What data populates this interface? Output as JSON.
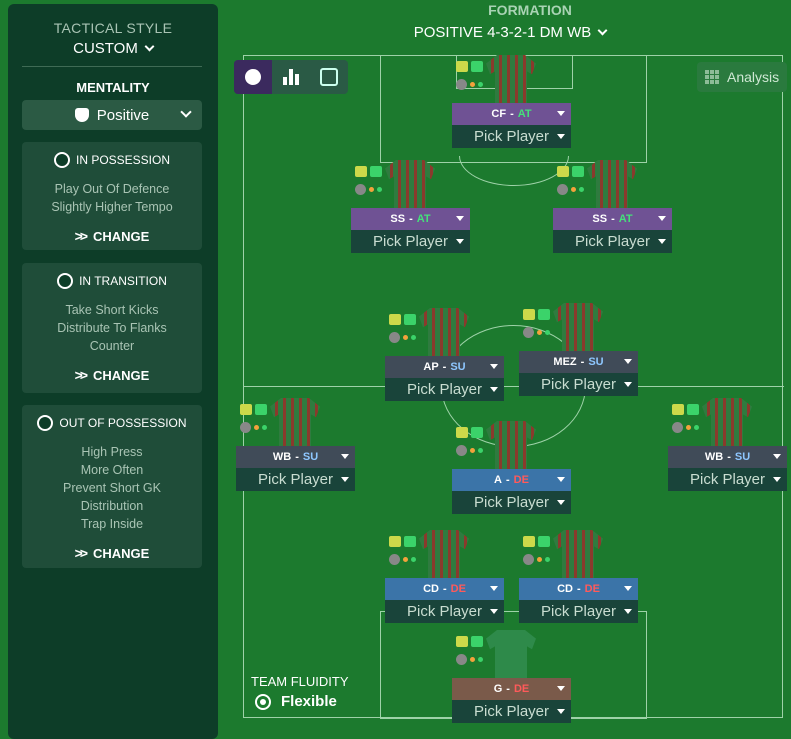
{
  "tactical_style": {
    "label": "TACTICAL STYLE",
    "value": "CUSTOM"
  },
  "mentality": {
    "label": "MENTALITY",
    "value": "Positive"
  },
  "cards": [
    {
      "title": "IN POSSESSION",
      "icon": "ball-icon",
      "lines": [
        "Play Out Of Defence",
        "Slightly Higher Tempo"
      ],
      "action": "CHANGE"
    },
    {
      "title": "IN TRANSITION",
      "icon": "transition-icon",
      "lines": [
        "Take Short Kicks",
        "Distribute To Flanks",
        "Counter"
      ],
      "action": "CHANGE"
    },
    {
      "title": "OUT OF POSSESSION",
      "icon": "defence-icon",
      "lines": [
        "High Press",
        "More Often",
        "Prevent Short GK",
        "Distribution",
        "Trap Inside"
      ],
      "action": "CHANGE"
    }
  ],
  "formation": {
    "label": "FORMATION",
    "value": "POSITIVE 4-3-2-1 DM WB"
  },
  "analysis_label": "Analysis",
  "pick_player": "Pick Player",
  "team_fluidity": {
    "label": "TEAM FLUIDITY",
    "value": "Flexible"
  },
  "positions": [
    {
      "pos": "CF",
      "duty": "AT"
    },
    {
      "pos": "SS",
      "duty": "AT"
    },
    {
      "pos": "SS",
      "duty": "AT"
    },
    {
      "pos": "AP",
      "duty": "SU"
    },
    {
      "pos": "MEZ",
      "duty": "SU"
    },
    {
      "pos": "WB",
      "duty": "SU"
    },
    {
      "pos": "A",
      "duty": "DE"
    },
    {
      "pos": "WB",
      "duty": "SU"
    },
    {
      "pos": "CD",
      "duty": "DE"
    },
    {
      "pos": "CD",
      "duty": "DE"
    },
    {
      "pos": "G",
      "duty": "DE"
    }
  ],
  "colors": {
    "attack_bar": "#6f5294",
    "attack_duty": "#45e07a",
    "support_bar": "#404b58",
    "support_duty": "#8ec7ff",
    "defence_bar": "#3b74a8",
    "defence_duty": "#ff5a5a",
    "keeper_bar": "#7a5a4a"
  }
}
